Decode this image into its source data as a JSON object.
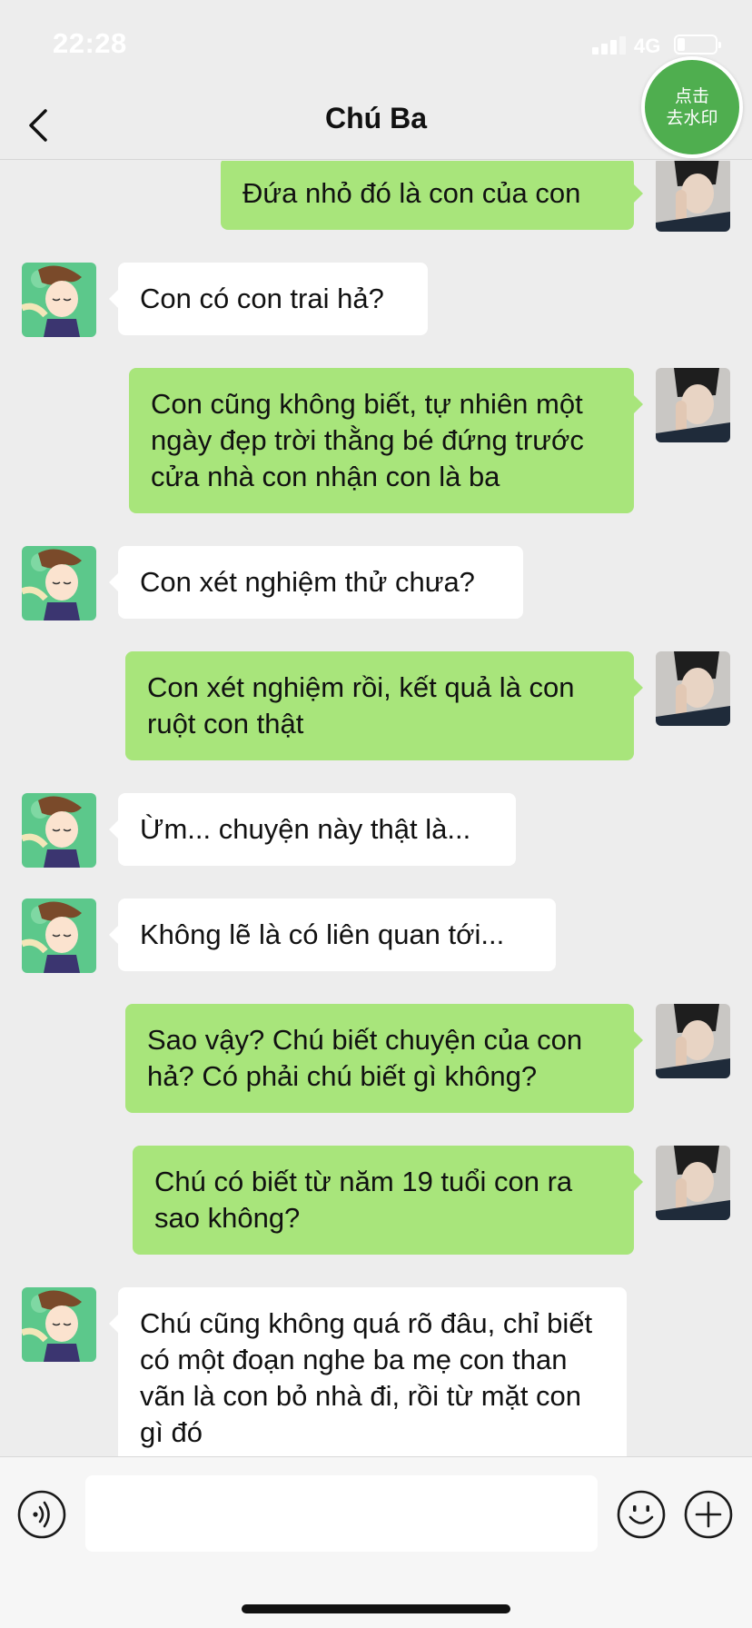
{
  "status_bar": {
    "time": "22:28",
    "network": "4G",
    "icons": [
      "signal-icon",
      "battery-icon"
    ]
  },
  "nav": {
    "back_icon": "chevron-left-icon",
    "title": "Chú Ba",
    "watermark_badge": {
      "line1": "点击",
      "line2": "去水印",
      "color": "#4fae4f"
    }
  },
  "colors": {
    "background": "#ededed",
    "sent_bubble": "#a8e57b",
    "received_bubble": "#ffffff"
  },
  "messages": [
    {
      "side": "right",
      "text": "Đứa nhỏ đó là con của con"
    },
    {
      "side": "left",
      "text": "Con có con trai hả?"
    },
    {
      "side": "right",
      "text": "Con cũng không biết, tự nhiên một ngày đẹp trời thằng bé đứng trước cửa nhà con nhận con là ba"
    },
    {
      "side": "left",
      "text": "Con xét nghiệm thử chưa?"
    },
    {
      "side": "right",
      "text": "Con xét nghiệm rồi, kết quả là con ruột con thật"
    },
    {
      "side": "left",
      "text": "Ừm... chuyện này thật là..."
    },
    {
      "side": "left",
      "text": "Không lẽ là có liên quan tới..."
    },
    {
      "side": "right",
      "text": "Sao vậy? Chú biết chuyện của con hả? Có phải chú biết gì không?"
    },
    {
      "side": "right",
      "text": "Chú có biết từ năm 19 tuổi con ra sao không?"
    },
    {
      "side": "left",
      "text": "Chú cũng không quá rõ đâu, chỉ biết có một đoạn nghe ba mẹ con than vãn là con bỏ nhà đi, rồi từ mặt con gì đó"
    }
  ],
  "input_bar": {
    "icons": [
      "voice-icon",
      "emoji-icon",
      "plus-icon"
    ],
    "value": "",
    "placeholder": ""
  }
}
